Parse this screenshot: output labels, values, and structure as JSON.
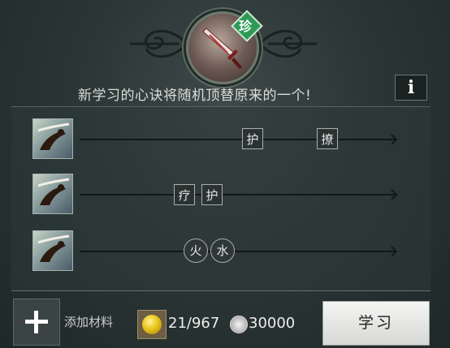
{
  "header": {
    "rarity_badge": "珍",
    "hint": "新学习的心诀将随机顶替原来的一个!",
    "info_button": "i",
    "icons": {
      "emblem": "sword-icon",
      "info": "info-icon"
    }
  },
  "rows": [
    {
      "icon": "martial-artist-icon",
      "tags": [
        {
          "label": "护",
          "style": "square"
        },
        {
          "label": "撩",
          "style": "square"
        }
      ]
    },
    {
      "icon": "martial-artist-icon",
      "tags": [
        {
          "label": "疗",
          "style": "square"
        },
        {
          "label": "护",
          "style": "square"
        }
      ]
    },
    {
      "icon": "martial-artist-icon",
      "tags": [
        {
          "label": "火",
          "style": "round"
        },
        {
          "label": "水",
          "style": "round"
        }
      ]
    }
  ],
  "footer": {
    "add_label": "添加材料",
    "coin_count": "21/967",
    "cost": "30000",
    "learn_button": "学习",
    "icons": {
      "add": "plus-icon",
      "coin": "gold-coin-icon",
      "cost": "silver-coin-icon"
    }
  },
  "colors": {
    "rarity": "#2e9a56",
    "background": "#2a3434"
  }
}
